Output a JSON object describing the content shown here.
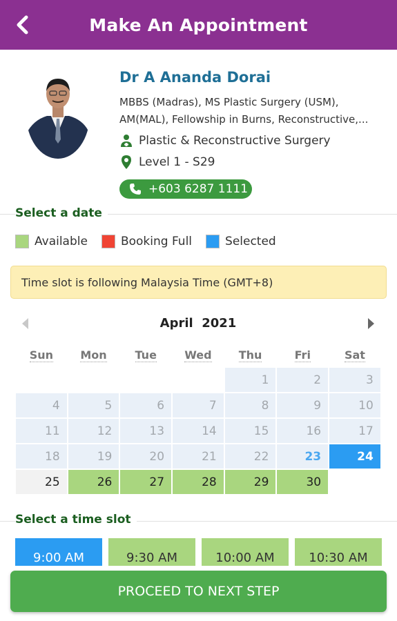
{
  "header": {
    "title": "Make An Appointment"
  },
  "doctor": {
    "name": "Dr A Ananda Dorai",
    "qualifications_line1": "MBBS (Madras), MS Plastic Surgery (USM),",
    "qualifications_line2": "AM(MAL), Fellowship in Burns, Reconstructive,...",
    "specialty": "Plastic & Reconstructive Surgery",
    "location": "Level 1 - S29",
    "phone": "+603 6287 1111"
  },
  "date_section": {
    "title": "Select a date"
  },
  "legend": [
    {
      "label": "Available",
      "color": "#a9d67f"
    },
    {
      "label": "Booking Full",
      "color": "#f04434"
    },
    {
      "label": "Selected",
      "color": "#2b9cf2"
    }
  ],
  "timezone_note": "Time slot is following Malaysia Time (GMT+8)",
  "calendar": {
    "month": "April",
    "year": "2021",
    "days_of_week": [
      "Sun",
      "Mon",
      "Tue",
      "Wed",
      "Thu",
      "Fri",
      "Sat"
    ],
    "weeks": [
      [
        {
          "d": "",
          "s": "empty"
        },
        {
          "d": "",
          "s": "empty"
        },
        {
          "d": "",
          "s": "empty"
        },
        {
          "d": "",
          "s": "empty"
        },
        {
          "d": "1",
          "s": "past"
        },
        {
          "d": "2",
          "s": "past"
        },
        {
          "d": "3",
          "s": "past"
        }
      ],
      [
        {
          "d": "4",
          "s": "past"
        },
        {
          "d": "5",
          "s": "past"
        },
        {
          "d": "6",
          "s": "past"
        },
        {
          "d": "7",
          "s": "past"
        },
        {
          "d": "8",
          "s": "past"
        },
        {
          "d": "9",
          "s": "past"
        },
        {
          "d": "10",
          "s": "past"
        }
      ],
      [
        {
          "d": "11",
          "s": "past"
        },
        {
          "d": "12",
          "s": "past"
        },
        {
          "d": "13",
          "s": "past"
        },
        {
          "d": "14",
          "s": "past"
        },
        {
          "d": "15",
          "s": "past"
        },
        {
          "d": "16",
          "s": "past"
        },
        {
          "d": "17",
          "s": "past"
        }
      ],
      [
        {
          "d": "18",
          "s": "past"
        },
        {
          "d": "19",
          "s": "past"
        },
        {
          "d": "20",
          "s": "past"
        },
        {
          "d": "21",
          "s": "past"
        },
        {
          "d": "22",
          "s": "past"
        },
        {
          "d": "23",
          "s": "today"
        },
        {
          "d": "24",
          "s": "selected"
        }
      ],
      [
        {
          "d": "25",
          "s": "plain"
        },
        {
          "d": "26",
          "s": "available"
        },
        {
          "d": "27",
          "s": "available"
        },
        {
          "d": "28",
          "s": "available"
        },
        {
          "d": "29",
          "s": "available"
        },
        {
          "d": "30",
          "s": "available"
        },
        {
          "d": "",
          "s": "empty"
        }
      ]
    ]
  },
  "time_section": {
    "title": "Select a time slot"
  },
  "time_slots": [
    {
      "label": "9:00 AM",
      "state": "selected"
    },
    {
      "label": "9:30 AM",
      "state": "available"
    },
    {
      "label": "10:00 AM",
      "state": "available"
    },
    {
      "label": "10:30 AM",
      "state": "available"
    }
  ],
  "proceed_label": "PROCEED TO NEXT STEP"
}
